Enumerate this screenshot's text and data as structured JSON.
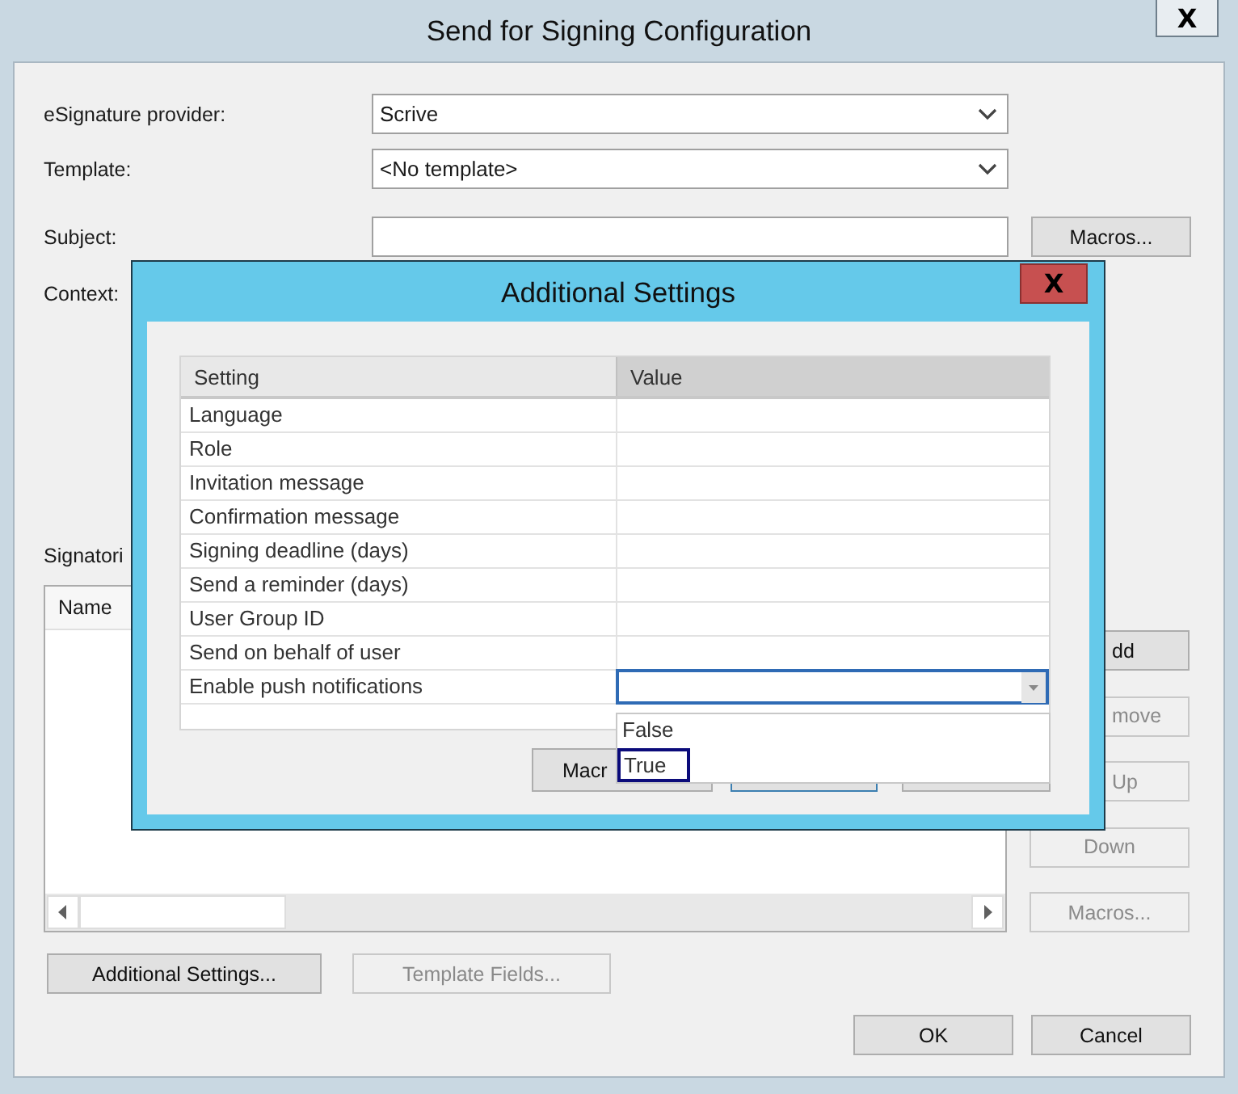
{
  "main_window": {
    "title": "Send for Signing Configuration",
    "close": "X"
  },
  "form": [
    {
      "label": "eSignature provider:",
      "kind": "select",
      "value": "Scrive"
    },
    {
      "label": "Template:",
      "kind": "select",
      "value": "<No template>"
    },
    {
      "label": "Subject:",
      "kind": "text",
      "button": "Macros..."
    }
  ],
  "context_label": "Context:",
  "signatories_label": "Signatori",
  "signatories_table": {
    "columns": [
      "Name"
    ]
  },
  "side_buttons": [
    {
      "label": "dd",
      "disabled": false
    },
    {
      "label": "move",
      "disabled": true
    },
    {
      "label": "Up",
      "disabled": true
    },
    {
      "label": "Down",
      "disabled": true
    },
    {
      "label": "Macros...",
      "disabled": true
    }
  ],
  "bottom_buttons": [
    {
      "label": "Additional Settings...",
      "disabled": false
    },
    {
      "label": "Template Fields...",
      "disabled": true
    }
  ],
  "dialog_buttons": [
    "OK",
    "Cancel"
  ],
  "additional_settings": {
    "title": "Additional Settings",
    "close": "X",
    "columns": [
      "Setting",
      "Value"
    ],
    "rows": [
      {
        "setting": "Language",
        "kind": "text"
      },
      {
        "setting": "Role",
        "kind": "text"
      },
      {
        "setting": "Invitation message",
        "kind": "text"
      },
      {
        "setting": "Confirmation message",
        "kind": "text"
      },
      {
        "setting": "Signing deadline (days)",
        "kind": "text"
      },
      {
        "setting": "Send a reminder (days)",
        "kind": "text"
      },
      {
        "setting": "User Group ID",
        "kind": "text"
      },
      {
        "setting": "Send on behalf of user",
        "kind": "text"
      },
      {
        "setting": "Enable push notifications",
        "kind": "dropdown",
        "expanded": true,
        "options": [
          {
            "label": "False",
            "selected": false
          },
          {
            "label": "True",
            "selected": true
          }
        ]
      }
    ],
    "buttons": [
      "Macr"
    ]
  }
}
